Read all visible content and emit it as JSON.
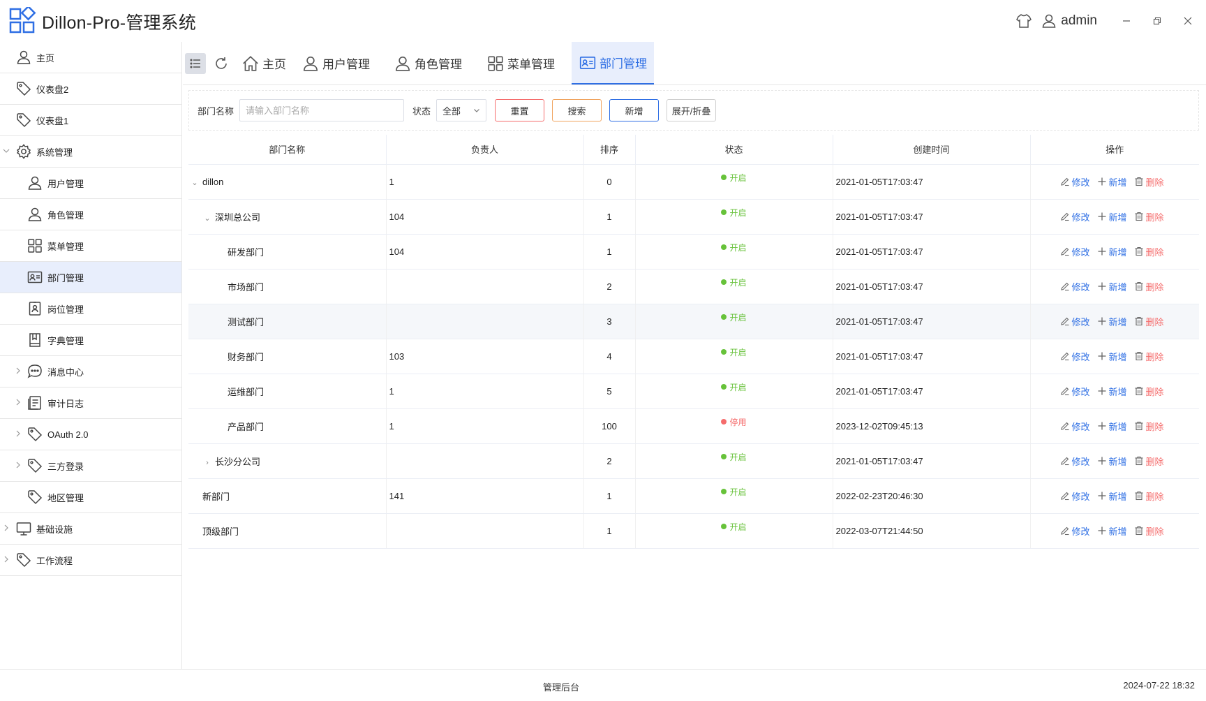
{
  "app": {
    "title": "Dillon-Pro-管理系统",
    "username": "admin"
  },
  "sidebar": {
    "items": [
      {
        "label": "主页",
        "icon": "user-icon",
        "level": 0,
        "arrow": ""
      },
      {
        "label": "仪表盘2",
        "icon": "tag-icon",
        "level": 0,
        "arrow": ""
      },
      {
        "label": "仪表盘1",
        "icon": "tag-icon",
        "level": 0,
        "arrow": ""
      },
      {
        "label": "系统管理",
        "icon": "gear-icon",
        "level": 0,
        "arrow": "down"
      },
      {
        "label": "用户管理",
        "icon": "user-icon",
        "level": 1,
        "arrow": ""
      },
      {
        "label": "角色管理",
        "icon": "user-icon",
        "level": 1,
        "arrow": ""
      },
      {
        "label": "菜单管理",
        "icon": "grid-icon",
        "level": 1,
        "arrow": ""
      },
      {
        "label": "部门管理",
        "icon": "id-card-icon",
        "level": 1,
        "arrow": "",
        "active": true
      },
      {
        "label": "岗位管理",
        "icon": "badge-icon",
        "level": 1,
        "arrow": ""
      },
      {
        "label": "字典管理",
        "icon": "book-icon",
        "level": 1,
        "arrow": ""
      },
      {
        "label": "消息中心",
        "icon": "chat-icon",
        "level": 1,
        "arrow": "right"
      },
      {
        "label": "审计日志",
        "icon": "document-icon",
        "level": 1,
        "arrow": "right"
      },
      {
        "label": "OAuth 2.0",
        "icon": "tag-icon",
        "level": 1,
        "arrow": "right"
      },
      {
        "label": "三方登录",
        "icon": "tag-icon",
        "level": 1,
        "arrow": "right"
      },
      {
        "label": "地区管理",
        "icon": "tag-icon",
        "level": 1,
        "arrow": ""
      },
      {
        "label": "基础设施",
        "icon": "monitor-icon",
        "level": 0,
        "arrow": "right"
      },
      {
        "label": "工作流程",
        "icon": "tag-icon",
        "level": 0,
        "arrow": "right"
      }
    ]
  },
  "tabs": [
    {
      "label": "主页",
      "icon": "home-icon"
    },
    {
      "label": "用户管理",
      "icon": "user-icon"
    },
    {
      "label": "角色管理",
      "icon": "user-icon"
    },
    {
      "label": "菜单管理",
      "icon": "grid-icon"
    },
    {
      "label": "部门管理",
      "icon": "id-card-icon",
      "active": true
    }
  ],
  "search": {
    "name_label": "部门名称",
    "name_placeholder": "请输入部门名称",
    "status_label": "状态",
    "status_value": "全部",
    "reset": "重置",
    "search": "搜索",
    "add": "新增",
    "toggle": "展开/折叠"
  },
  "table": {
    "columns": [
      "部门名称",
      "负责人",
      "排序",
      "状态",
      "创建时间",
      "操作"
    ],
    "actions": {
      "edit": "修改",
      "add": "新增",
      "delete": "删除"
    },
    "rows": [
      {
        "name": "dillon",
        "depth": 0,
        "expand": "down",
        "leader": "1",
        "sort": "0",
        "status": "开启",
        "on": true,
        "time": "2021-01-05T17:03:47"
      },
      {
        "name": "深圳总公司",
        "depth": 1,
        "expand": "down",
        "leader": "104",
        "sort": "1",
        "status": "开启",
        "on": true,
        "time": "2021-01-05T17:03:47"
      },
      {
        "name": "研发部门",
        "depth": 2,
        "expand": "",
        "leader": "104",
        "sort": "1",
        "status": "开启",
        "on": true,
        "time": "2021-01-05T17:03:47"
      },
      {
        "name": "市场部门",
        "depth": 2,
        "expand": "",
        "leader": "",
        "sort": "2",
        "status": "开启",
        "on": true,
        "time": "2021-01-05T17:03:47"
      },
      {
        "name": "测试部门",
        "depth": 2,
        "expand": "",
        "leader": "",
        "sort": "3",
        "status": "开启",
        "on": true,
        "time": "2021-01-05T17:03:47",
        "highlight": true
      },
      {
        "name": "财务部门",
        "depth": 2,
        "expand": "",
        "leader": "103",
        "sort": "4",
        "status": "开启",
        "on": true,
        "time": "2021-01-05T17:03:47"
      },
      {
        "name": "运维部门",
        "depth": 2,
        "expand": "",
        "leader": "1",
        "sort": "5",
        "status": "开启",
        "on": true,
        "time": "2021-01-05T17:03:47"
      },
      {
        "name": "产品部门",
        "depth": 2,
        "expand": "",
        "leader": "1",
        "sort": "100",
        "status": "停用",
        "on": false,
        "time": "2023-12-02T09:45:13"
      },
      {
        "name": "长沙分公司",
        "depth": 1,
        "expand": "right",
        "leader": "",
        "sort": "2",
        "status": "开启",
        "on": true,
        "time": "2021-01-05T17:03:47"
      },
      {
        "name": "新部门",
        "depth": 0,
        "expand": "",
        "leader": "141",
        "sort": "1",
        "status": "开启",
        "on": true,
        "time": "2022-02-23T20:46:30"
      },
      {
        "name": "顶级部门",
        "depth": 0,
        "expand": "",
        "leader": "",
        "sort": "1",
        "status": "开启",
        "on": true,
        "time": "2022-03-07T21:44:50"
      }
    ]
  },
  "footer": {
    "center": "管理后台",
    "datetime": "2024-07-22 18:32"
  },
  "colors": {
    "primary": "#2f6fe4",
    "success": "#67c23a",
    "danger": "#f56c6c",
    "active_bg": "#e8eefc"
  }
}
